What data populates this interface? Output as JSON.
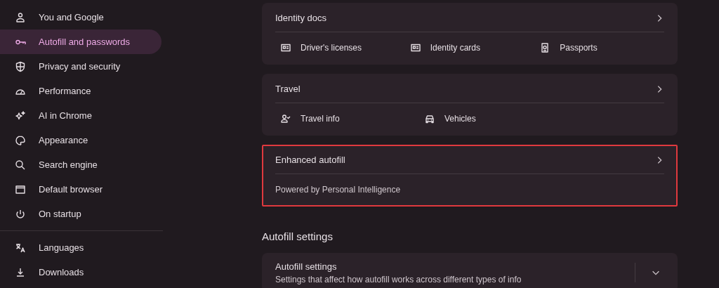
{
  "sidebar": {
    "groups": [
      {
        "items": [
          {
            "label": "You and Google",
            "selected": false
          },
          {
            "label": "Autofill and passwords",
            "selected": true
          },
          {
            "label": "Privacy and security",
            "selected": false
          },
          {
            "label": "Performance",
            "selected": false
          },
          {
            "label": "AI in Chrome",
            "selected": false
          },
          {
            "label": "Appearance",
            "selected": false
          },
          {
            "label": "Search engine",
            "selected": false
          },
          {
            "label": "Default browser",
            "selected": false
          },
          {
            "label": "On startup",
            "selected": false
          }
        ]
      },
      {
        "items": [
          {
            "label": "Languages",
            "selected": false
          },
          {
            "label": "Downloads",
            "selected": false
          }
        ]
      }
    ]
  },
  "content": [
    {
      "kind": "links",
      "title": "Identity docs",
      "highlighted": false,
      "links": [
        {
          "label": "Driver's licenses"
        },
        {
          "label": "Identity cards"
        },
        {
          "label": "Passports"
        }
      ]
    },
    {
      "kind": "links",
      "title": "Travel",
      "highlighted": false,
      "links": [
        {
          "label": "Travel info"
        },
        {
          "label": "Vehicles"
        }
      ]
    },
    {
      "kind": "subtitle",
      "title": "Enhanced autofill",
      "highlighted": true,
      "subtitle": "Powered by Personal Intelligence"
    },
    {
      "kind": "heading",
      "title": "Autofill settings"
    },
    {
      "kind": "expandable",
      "title": "Autofill settings",
      "highlighted": false,
      "description": "Settings that affect how autofill works across different types of info"
    }
  ]
}
